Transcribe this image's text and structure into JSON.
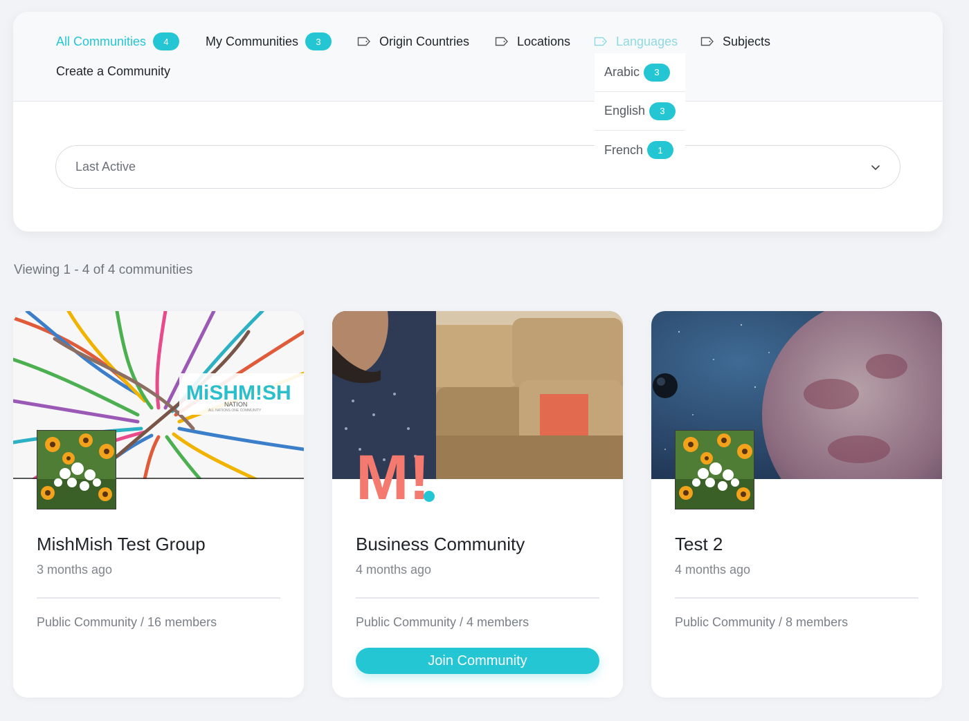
{
  "nav": {
    "all_communities": {
      "label": "All Communities",
      "count": "4"
    },
    "my_communities": {
      "label": "My Communities",
      "count": "3"
    },
    "origin_countries": "Origin Countries",
    "locations": "Locations",
    "languages": "Languages",
    "subjects": "Subjects",
    "create_community": "Create a Community"
  },
  "languages_dropdown": [
    {
      "label": "Arabic",
      "count": "3"
    },
    {
      "label": "English",
      "count": "3"
    },
    {
      "label": "French",
      "count": "1"
    }
  ],
  "sort": {
    "selected": "Last Active"
  },
  "viewing_text": "Viewing 1 - 4 of 4 communities",
  "communities": [
    {
      "title": "MishMish Test Group",
      "time": "3 months ago",
      "meta": "Public Community / 16 members",
      "cover_brand": "MiSHM!SH",
      "cover_brand_sub": "NATION",
      "cover_brand_tag": "ALL NATIONS ONE COMMUNITY"
    },
    {
      "title": "Business Community",
      "time": "4 months ago",
      "meta": "Public Community / 4 members",
      "join_label": "Join Community",
      "avatar_logo": "M!"
    },
    {
      "title": "Test 2",
      "time": "4 months ago",
      "meta": "Public Community / 8 members"
    }
  ],
  "colors": {
    "accent": "#25c6d4",
    "logo_coral": "#f47a6f"
  }
}
